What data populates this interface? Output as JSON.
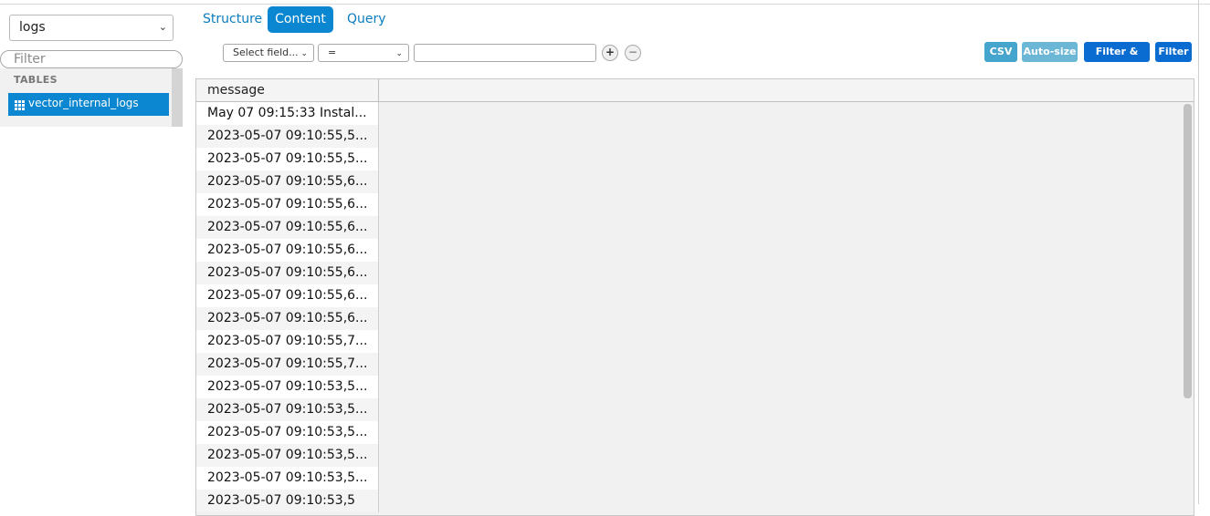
{
  "sidebar": {
    "database": "logs",
    "filter_placeholder": "Filter",
    "tables_heading": "TABLES",
    "tables": [
      {
        "label": "vector_internal_logs",
        "selected": true
      }
    ]
  },
  "tabs": {
    "structure": "Structure",
    "content": "Content",
    "query": "Query",
    "active": "Content"
  },
  "filter_bar": {
    "field_select": "Select field...",
    "operator_select": "=",
    "value": "",
    "add_icon": "plus-icon",
    "remove_icon": "minus-icon"
  },
  "actions": {
    "csv": "CSV",
    "auto_size": "Auto-size",
    "filter_sort": "Filter & sort",
    "filter": "Filter"
  },
  "grid": {
    "columns": [
      "message"
    ],
    "rows": [
      "May 07 09:15:33 Instal...",
      "2023-05-07 09:10:55,5...",
      "2023-05-07 09:10:55,5...",
      "2023-05-07 09:10:55,6...",
      "2023-05-07 09:10:55,6...",
      "2023-05-07 09:10:55,6...",
      "2023-05-07 09:10:55,6...",
      "2023-05-07 09:10:55,6...",
      "2023-05-07 09:10:55,6...",
      "2023-05-07 09:10:55,6...",
      "2023-05-07 09:10:55,7...",
      "2023-05-07 09:10:55,7...",
      "2023-05-07 09:10:53,5...",
      "2023-05-07 09:10:53,5...",
      "2023-05-07 09:10:53,5...",
      "2023-05-07 09:10:53,5...",
      "2023-05-07 09:10:53,5...",
      "2023-05-07 09:10:53,5"
    ]
  },
  "colors": {
    "accent": "#0a87d0",
    "button_primary": "#0a6cd1",
    "button_csv": "#46a5cc",
    "button_autosize": "#6cb7d6"
  }
}
